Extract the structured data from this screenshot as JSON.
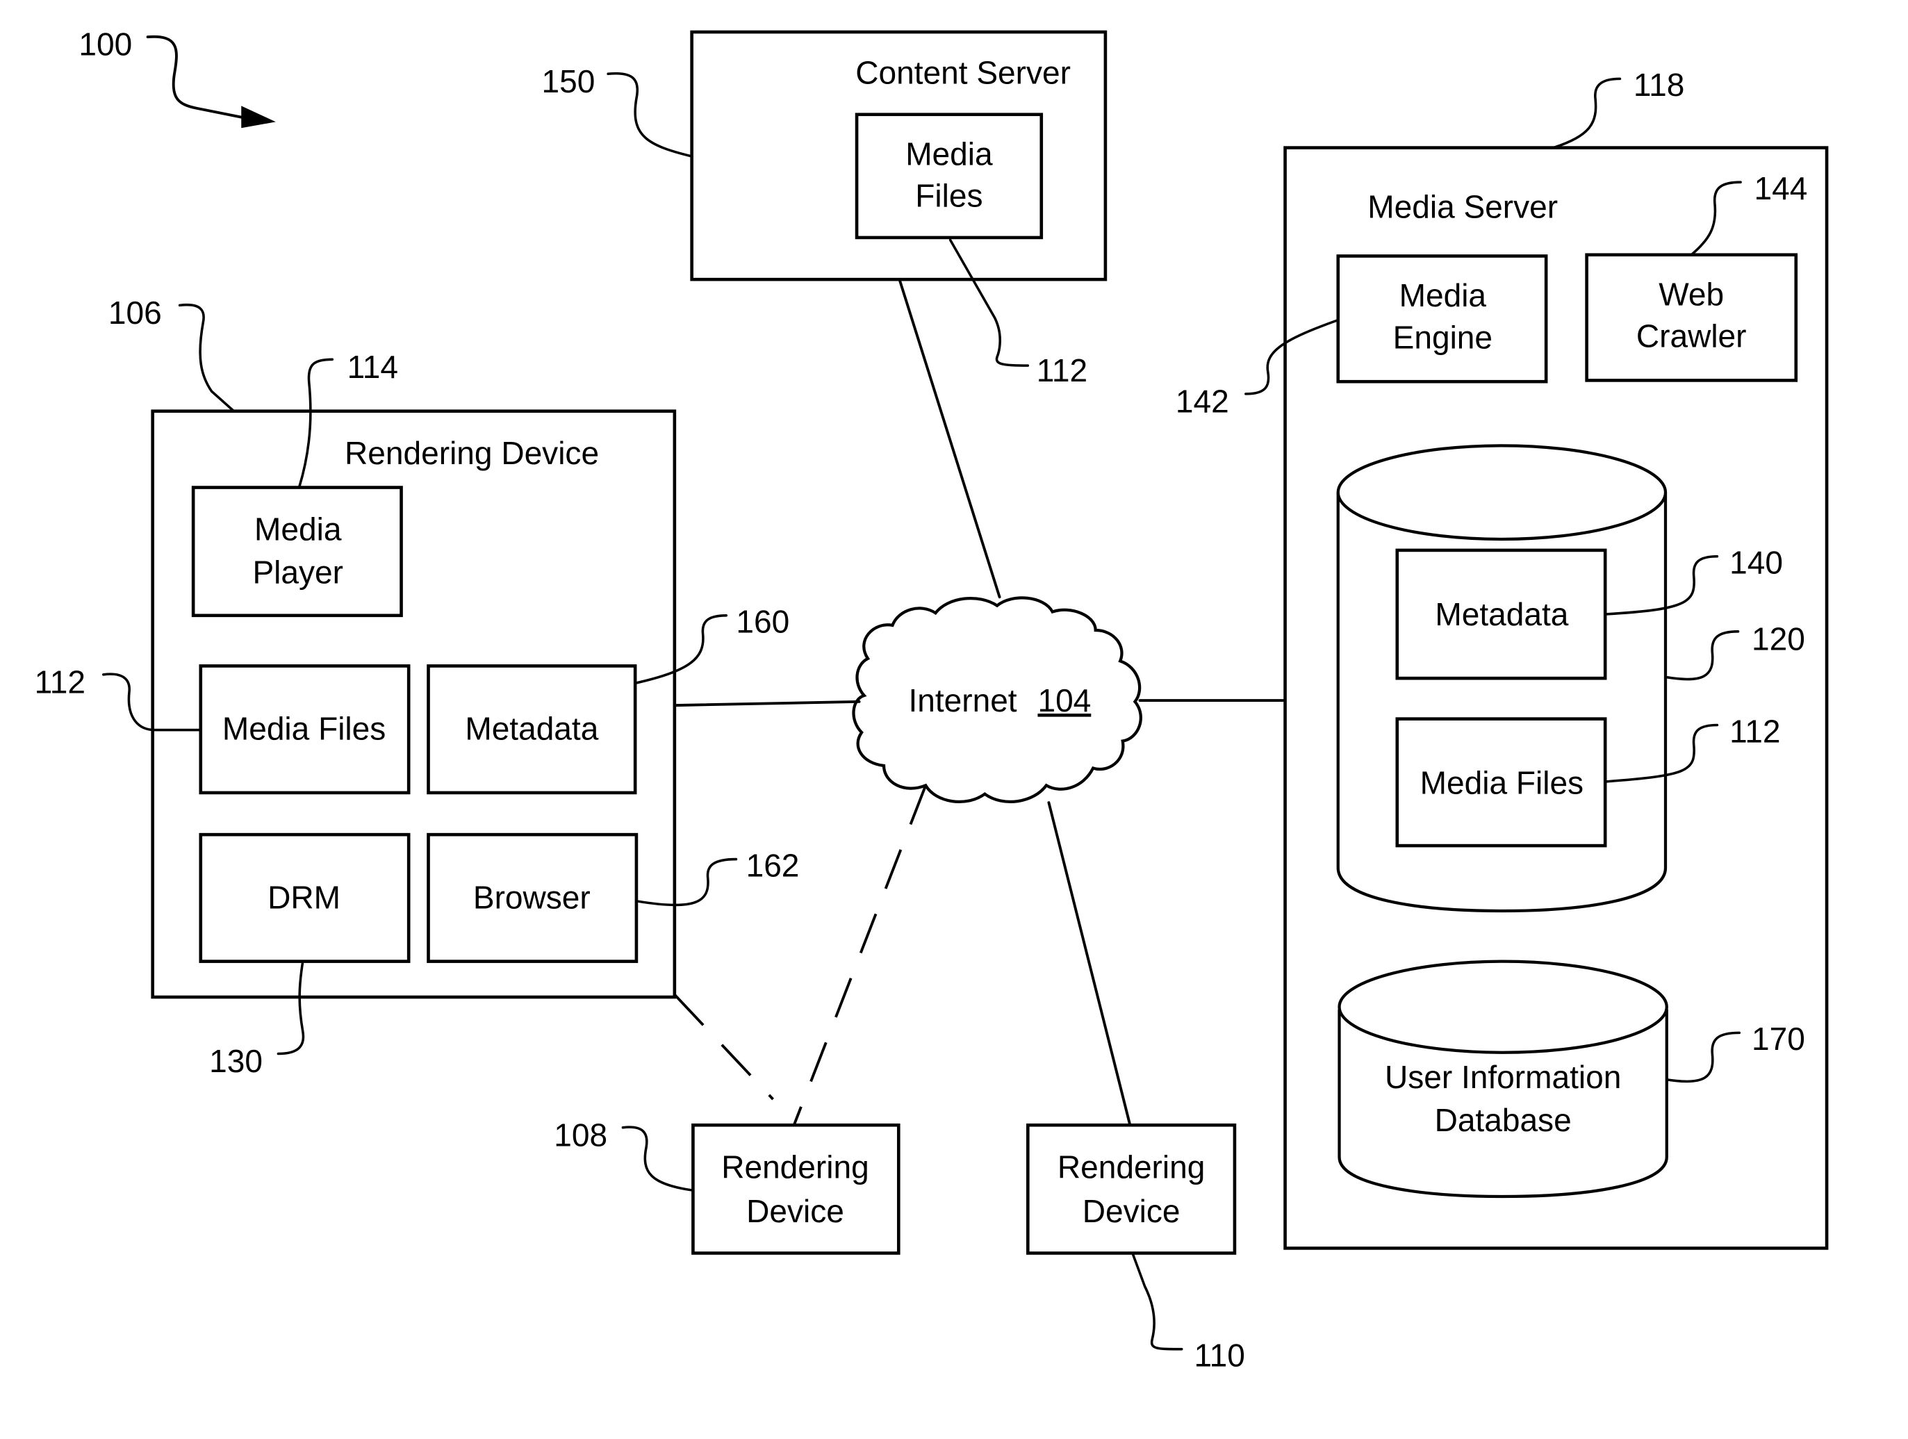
{
  "figure": {
    "ref": "100",
    "network": {
      "label": "Internet",
      "ref": "104"
    },
    "content_server": {
      "title": "Content Server",
      "ref": "150",
      "media_files": {
        "line1": "Media",
        "line2": "Files",
        "ref": "112"
      }
    },
    "rendering_device_main": {
      "title": "Rendering Device",
      "ref": "106",
      "media_player": {
        "line1": "Media",
        "line2": "Player",
        "ref": "114"
      },
      "media_files": {
        "label": "Media Files",
        "ref": "112"
      },
      "metadata": {
        "label": "Metadata",
        "ref": "160"
      },
      "drm": {
        "label": "DRM",
        "ref": "130"
      },
      "browser": {
        "label": "Browser",
        "ref": "162"
      }
    },
    "rendering_device_108": {
      "line1": "Rendering",
      "line2": "Device",
      "ref": "108"
    },
    "rendering_device_110": {
      "line1": "Rendering",
      "line2": "Device",
      "ref": "110"
    },
    "media_server": {
      "title": "Media Server",
      "ref": "118",
      "media_engine": {
        "line1": "Media",
        "line2": "Engine",
        "ref": "142"
      },
      "web_crawler": {
        "line1": "Web",
        "line2": "Crawler",
        "ref": "144"
      },
      "database": {
        "ref": "120",
        "metadata": {
          "label": "Metadata",
          "ref": "140"
        },
        "media_files": {
          "label": "Media Files",
          "ref": "112"
        }
      },
      "user_db": {
        "line1": "User Information",
        "line2": "Database",
        "ref": "170"
      }
    }
  }
}
